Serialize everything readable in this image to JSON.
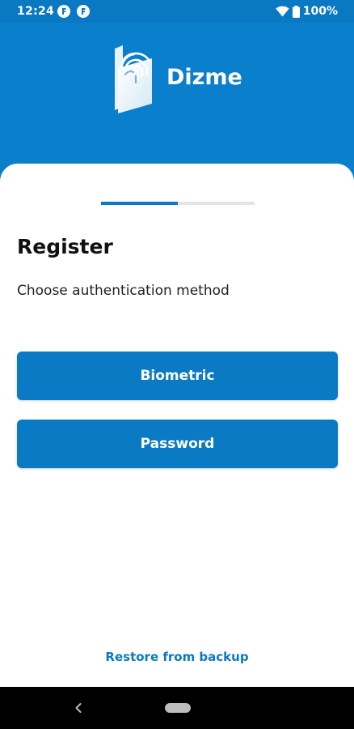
{
  "status_bar": {
    "time": "12:24",
    "battery_percent": "100%",
    "icons": [
      "app-notification-icon",
      "app-notification-icon",
      "wifi-icon",
      "battery-icon"
    ]
  },
  "header": {
    "brand_name": "Dizme",
    "logo_icon": "fingerprint-card-icon"
  },
  "registration": {
    "progress_fraction": 0.5,
    "title": "Register",
    "subtitle": "Choose authentication method",
    "biometric_label": "Biometric",
    "password_label": "Password",
    "restore_label": "Restore from backup"
  },
  "nav_bar": {
    "icons": [
      "back-icon",
      "home-pill-icon"
    ]
  },
  "colors": {
    "brand_blue": "#0a80cc",
    "button_blue": "#0a7ac4",
    "status_bar_blue": "#0a78c2"
  }
}
